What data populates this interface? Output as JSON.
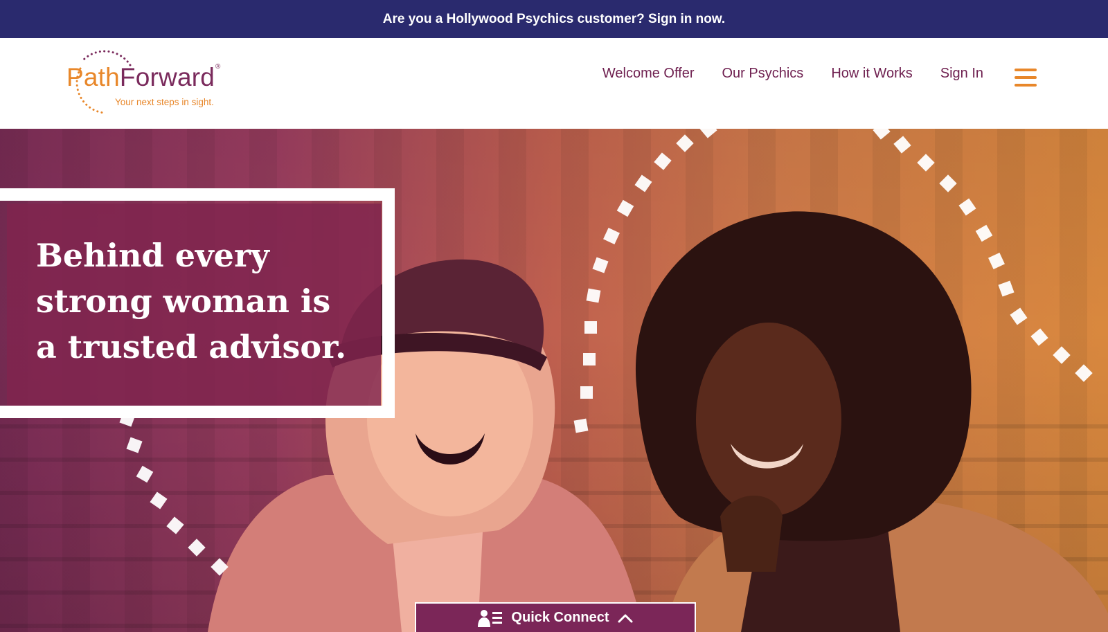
{
  "promo_banner": {
    "text": "Are you a Hollywood Psychics customer? Sign in now."
  },
  "logo": {
    "word_part1": "Path",
    "word_part2": "Forward",
    "registered": "®",
    "tagline": "Your next steps in sight."
  },
  "nav": {
    "items": [
      {
        "label": "Welcome Offer"
      },
      {
        "label": "Our Psychics"
      },
      {
        "label": "How it Works"
      },
      {
        "label": "Sign In"
      }
    ],
    "menu_icon": "hamburger-menu-icon"
  },
  "hero": {
    "headline_lines": [
      "Behind every",
      "strong woman is",
      "a trusted advisor."
    ],
    "image_subject": "two-women-laughing-photo"
  },
  "quick_connect": {
    "label": "Quick Connect",
    "icon": "contact-list-icon",
    "chevron": "chevron-up-icon"
  },
  "colors": {
    "banner": "#2a2a6e",
    "brand_plum": "#7a2a5c",
    "brand_orange": "#e8872a",
    "white": "#ffffff"
  }
}
